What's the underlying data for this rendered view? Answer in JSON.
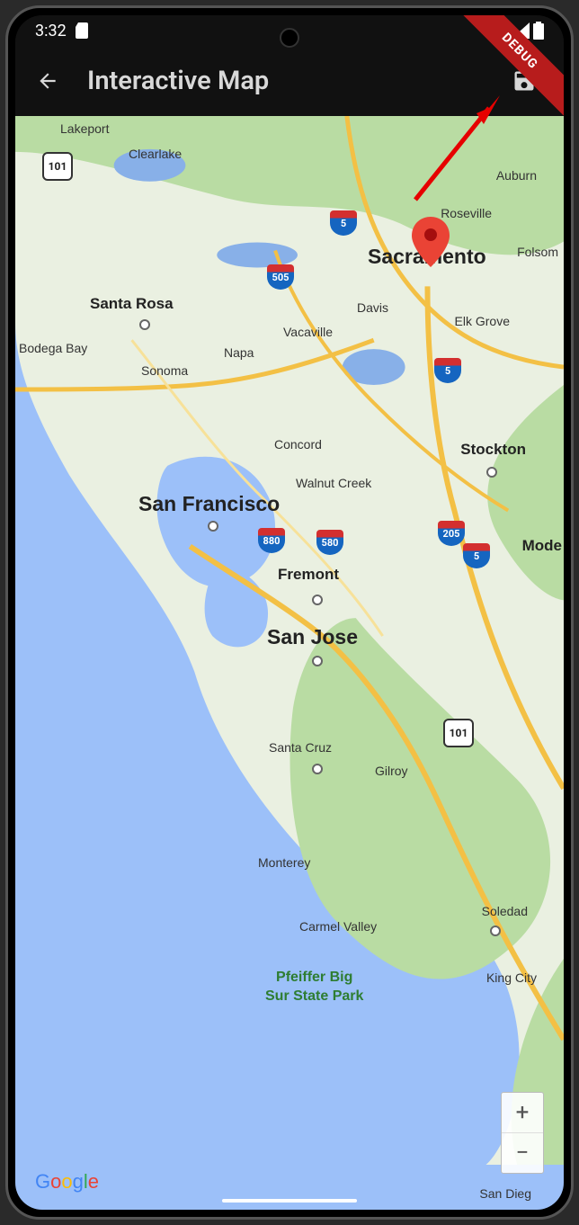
{
  "status": {
    "time": "3:32",
    "wifi": true,
    "signal": true,
    "battery": true,
    "sdcard": true
  },
  "appbar": {
    "title": "Interactive Map",
    "back_aria": "Back",
    "save_aria": "Save"
  },
  "debug": {
    "label": "DEBUG"
  },
  "marker": {
    "lat_label": "Sacramento"
  },
  "cities": {
    "sacramento": "Sacramento",
    "sanfrancisco": "San Francisco",
    "sanjose": "San Jose",
    "stockton": "Stockton",
    "fremont": "Fremont",
    "santarosa": "Santa Rosa",
    "modesto": "Mode",
    "lakeport": "Lakeport",
    "clearlake": "Clearlake",
    "auburn": "Auburn",
    "roseville": "Roseville",
    "folsom": "Folsom",
    "davis": "Davis",
    "elkgrove": "Elk Grove",
    "vacaville": "Vacaville",
    "napa": "Napa",
    "sonoma": "Sonoma",
    "bodegabay": "Bodega Bay",
    "concord": "Concord",
    "walnutcreek": "Walnut Creek",
    "santacruz": "Santa Cruz",
    "gilroy": "Gilroy",
    "monterey": "Monterey",
    "carmelvalley": "Carmel Valley",
    "soledad": "Soledad",
    "kingcity": "King City",
    "sandiegobottom": "San Dieg",
    "pfeiffer": "Pfeiffer Big\nSur State Park"
  },
  "highways": {
    "i5a": "5",
    "i5b": "5",
    "i5c": "5",
    "i505": "505",
    "i880": "880",
    "i580": "580",
    "i205": "205",
    "us101a": "101",
    "us101b": "101"
  },
  "google": {
    "g": "G",
    "o1": "o",
    "o2": "o",
    "g2": "g",
    "l": "l",
    "e": "e"
  },
  "zoom": {
    "in": "+",
    "out": "−"
  }
}
